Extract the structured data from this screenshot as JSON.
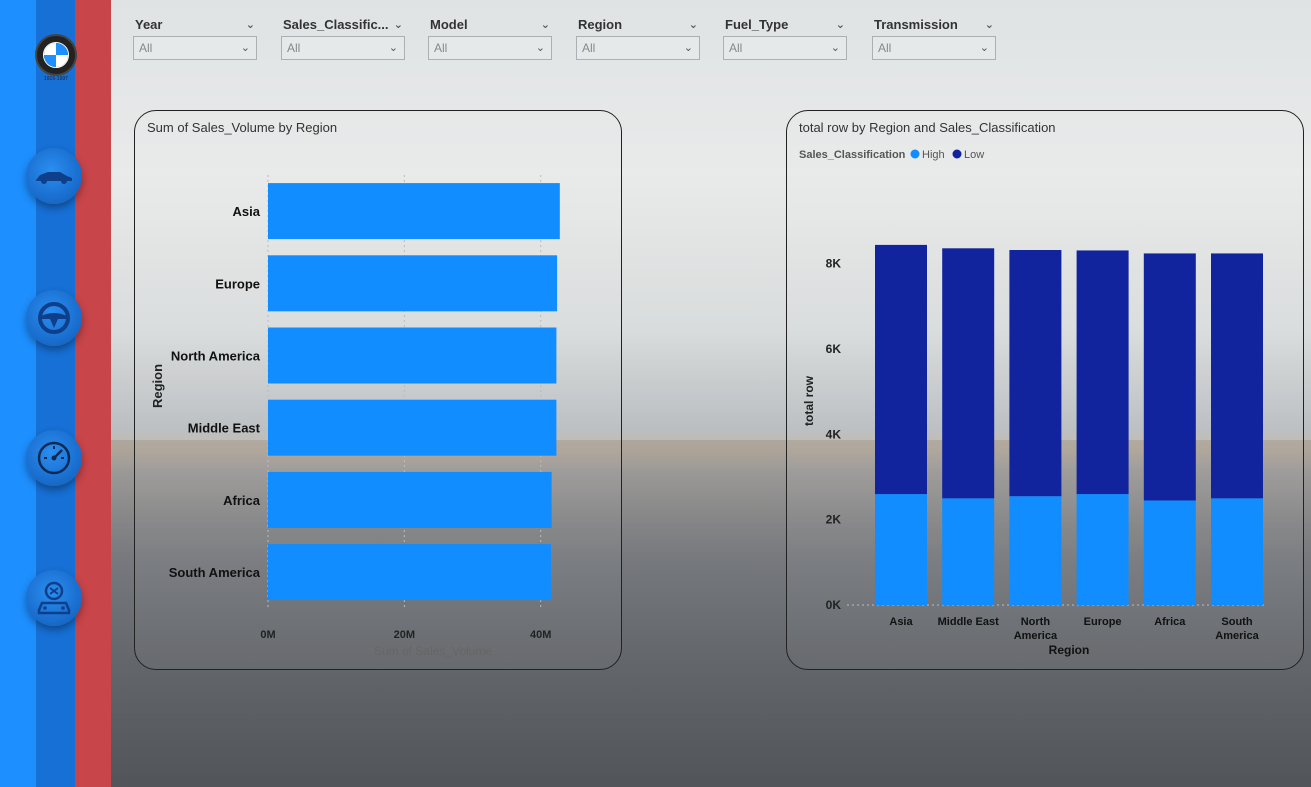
{
  "brand": {
    "logo": "BMW",
    "logo_caption": "1916-1997"
  },
  "colors": {
    "high": "#118dff",
    "low": "#12239e",
    "rail_blue": "#1e8fff",
    "rail_dark": "#1670d6",
    "rail_red": "#c8454a"
  },
  "nav": {
    "icons": [
      "car-icon",
      "steering-wheel-icon",
      "speedometer-icon",
      "car-service-icon"
    ]
  },
  "slicers": [
    {
      "title": "Year",
      "value": "All"
    },
    {
      "title": "Sales_Classific...",
      "value": "All"
    },
    {
      "title": "Model",
      "value": "All"
    },
    {
      "title": "Region",
      "value": "All"
    },
    {
      "title": "Fuel_Type",
      "value": "All"
    },
    {
      "title": "Transmission",
      "value": "All"
    }
  ],
  "chart_data": [
    {
      "type": "bar",
      "orientation": "horizontal",
      "title": "Sum of Sales_Volume by Region",
      "xlabel": "Sum of Sales_Volume",
      "ylabel": "Region",
      "categories": [
        "Asia",
        "Europe",
        "North America",
        "Middle East",
        "Africa",
        "South America"
      ],
      "values": [
        42.8,
        42.4,
        42.3,
        42.3,
        41.6,
        41.5
      ],
      "unit": "M",
      "xticks": [
        "0M",
        "20M",
        "40M"
      ],
      "xlim": [
        0,
        44
      ],
      "grid": true,
      "color": "#118dff"
    },
    {
      "type": "bar",
      "stacked": true,
      "title": "total row by Region and Sales_Classification",
      "legend_title": "Sales_Classification",
      "legend_position": "top-left",
      "xlabel": "Region",
      "ylabel": "total row",
      "categories": [
        "Asia",
        "Middle East",
        "North America",
        "Europe",
        "Africa",
        "South America"
      ],
      "series": [
        {
          "name": "High",
          "color": "#118dff",
          "values": [
            2600,
            2500,
            2550,
            2600,
            2450,
            2500
          ]
        },
        {
          "name": "Low",
          "color": "#12239e",
          "values": [
            5840,
            5860,
            5770,
            5710,
            5790,
            5740
          ]
        }
      ],
      "yticks": [
        "0K",
        "2K",
        "4K",
        "6K",
        "8K"
      ],
      "ylim": [
        0,
        9000
      ]
    }
  ]
}
